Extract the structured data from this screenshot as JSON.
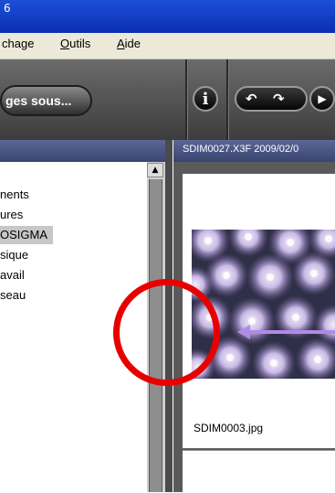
{
  "window": {
    "title_fragment": "6"
  },
  "menu": [
    {
      "label": "chage",
      "underline": ""
    },
    {
      "label": "utils",
      "underline": "O"
    },
    {
      "label": "ide",
      "underline": "A"
    }
  ],
  "toolbar": {
    "save_label": "ges sous...",
    "info_icon": "info-icon",
    "rotate_left_icon": "rotate-left-icon",
    "rotate_right_icon": "rotate-right-icon",
    "play_icon": "play-icon"
  },
  "right_panel": {
    "header": "SDIM0027.X3F 2009/02/0"
  },
  "tree": {
    "items": [
      "nents",
      "ures",
      "OSIGMA",
      "sique",
      "avail",
      "seau"
    ],
    "selected_index": 2
  },
  "thumbnail": {
    "filename": "SDIM0003.jpg"
  },
  "annotation": {
    "color": "#e80000"
  }
}
